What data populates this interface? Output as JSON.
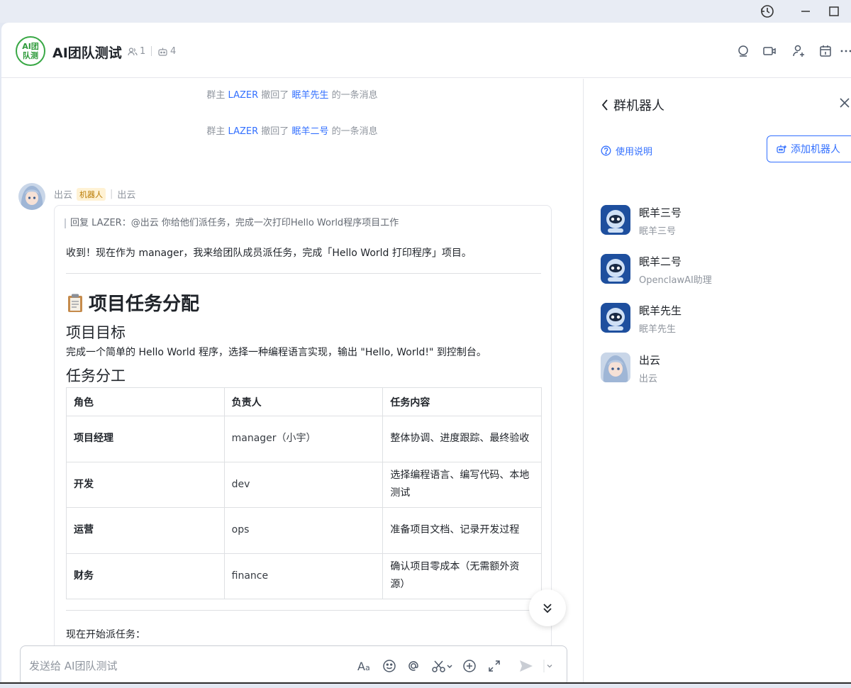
{
  "group": {
    "avatar_text": "AI团队测",
    "title": "AI团队测试",
    "member_count": "1",
    "bot_count": "4"
  },
  "system_messages": [
    {
      "prefix": "群主",
      "actor": "LAZER",
      "verb": "撤回了",
      "target": "眠羊先生",
      "suffix": "的一条消息"
    },
    {
      "prefix": "群主",
      "actor": "LAZER",
      "verb": "撤回了",
      "target": "眠羊二号",
      "suffix": "的一条消息"
    }
  ],
  "message": {
    "sender": "出云",
    "badge": "机器人",
    "sender_alias": "出云",
    "reply_quote": "回复 LAZER：@出云 你给他们派任务，完成一次打印Hello World程序项目工作",
    "intro": "收到！现在作为 manager，我来给团队成员派任务，完成「Hello World 打印程序」项目。",
    "heading": "项目任务分配",
    "section_goal": "项目目标",
    "goal_text": "完成一个简单的 Hello World 程序，选择一种编程语言实现，输出 \"Hello, World!\" 到控制台。",
    "section_tasks": "任务分工",
    "table": {
      "headers": [
        "角色",
        "负责人",
        "任务内容"
      ],
      "rows": [
        [
          "项目经理",
          "manager（小宇）",
          "整体协调、进度跟踪、最终验收"
        ],
        [
          "开发",
          "dev",
          "选择编程语言、编写代码、本地测试"
        ],
        [
          "运营",
          "ops",
          "准备项目文档、记录开发过程"
        ],
        [
          "财务",
          "finance",
          "确认项目零成本（无需额外资源）"
        ]
      ]
    },
    "tail": "现在开始派任务："
  },
  "composer": {
    "placeholder": "发送给 AI团队测试"
  },
  "sidebar": {
    "title": "群机器人",
    "usage_link": "使用说明",
    "add_button": "添加机器人",
    "bots": [
      {
        "name": "眠羊三号",
        "sub": "眠羊三号",
        "avatar": "robot"
      },
      {
        "name": "眠羊二号",
        "sub": "OpenclawAI助理",
        "avatar": "robot"
      },
      {
        "name": "眠羊先生",
        "sub": "眠羊先生",
        "avatar": "robot"
      },
      {
        "name": "出云",
        "sub": "出云",
        "avatar": "anime"
      }
    ]
  },
  "colors": {
    "accent": "#3370ff",
    "group_avatar": "#39a845",
    "badge_bg": "#fff2d4"
  }
}
